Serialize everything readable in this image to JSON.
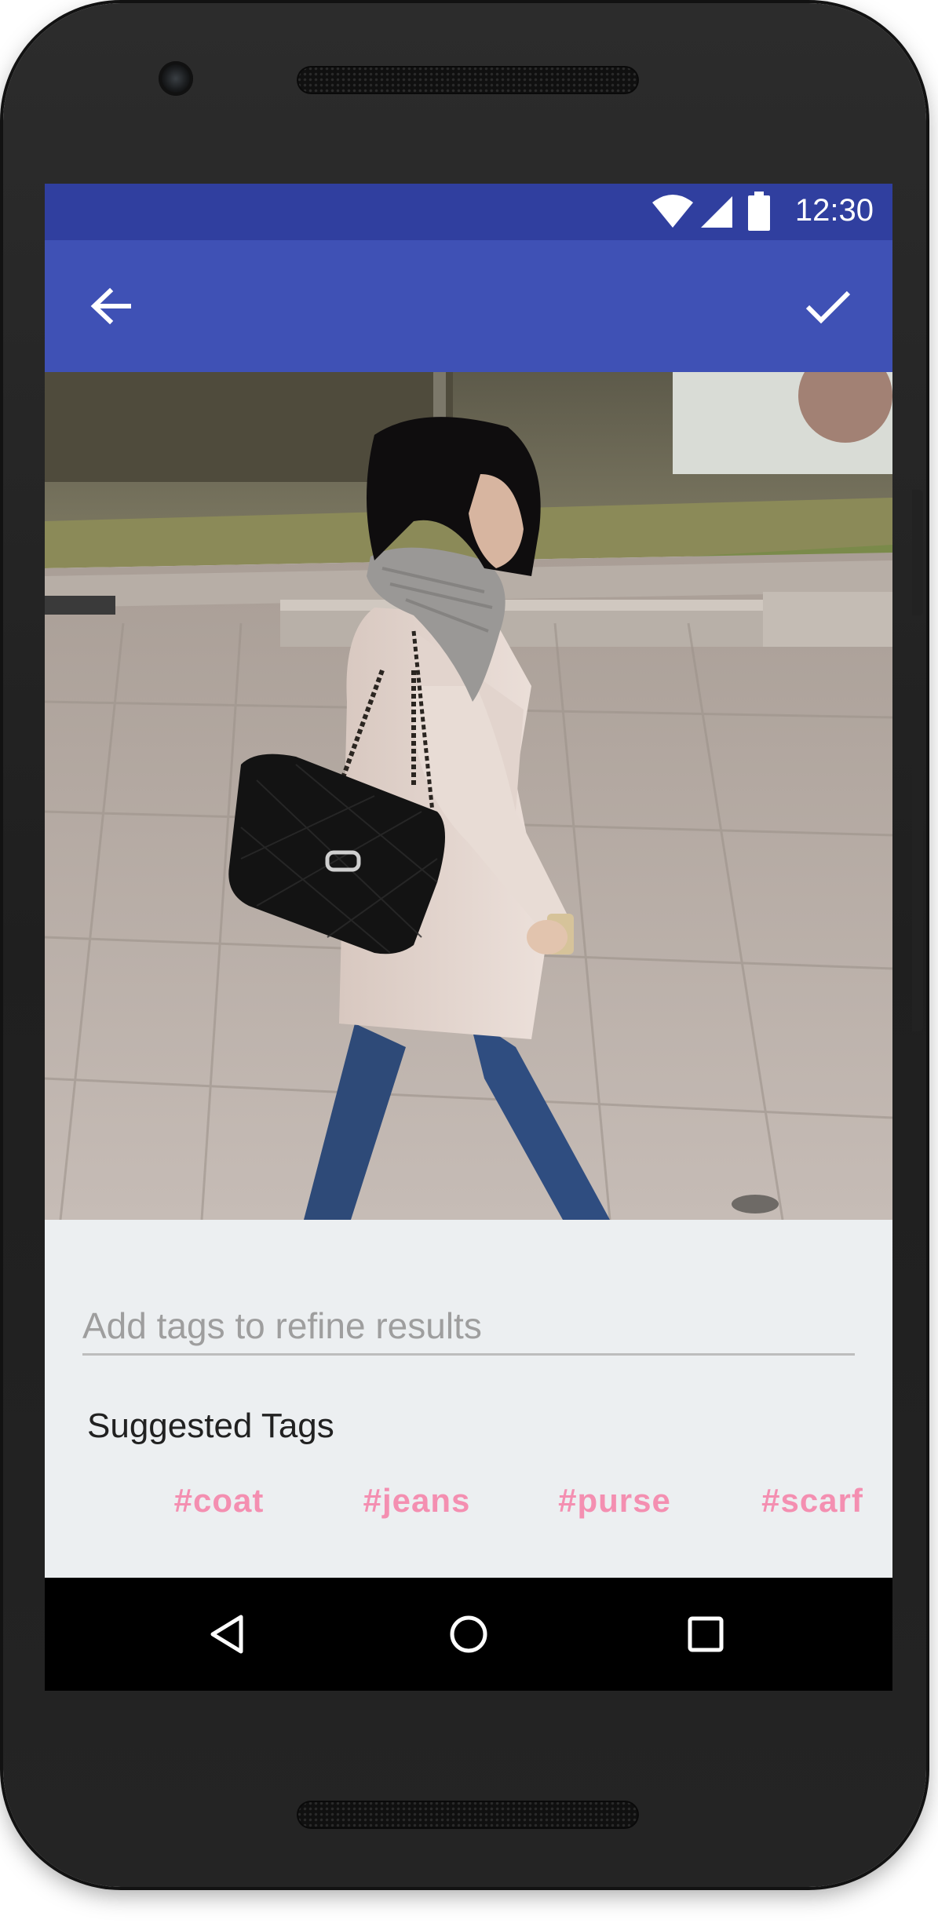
{
  "status_bar": {
    "time": "12:30",
    "icons": [
      "wifi-icon",
      "cell-signal-icon",
      "battery-icon"
    ]
  },
  "toolbar": {
    "back_icon": "arrow-back-icon",
    "confirm_icon": "check-icon"
  },
  "photo": {
    "subject": "woman-walking-with-purse"
  },
  "tag_search": {
    "placeholder": "Add tags to refine results",
    "value": ""
  },
  "suggested": {
    "title": "Suggested Tags",
    "tags": [
      "#coat",
      "#jeans",
      "#purse",
      "#scarf"
    ]
  },
  "nav_bar": {
    "icons": [
      "back-triangle-icon",
      "home-circle-icon",
      "recents-square-icon"
    ]
  },
  "colors": {
    "status_bar": "#303f9f",
    "toolbar": "#3f51b5",
    "tag_accent": "#f48fb1",
    "content_bg": "#eceff1"
  }
}
